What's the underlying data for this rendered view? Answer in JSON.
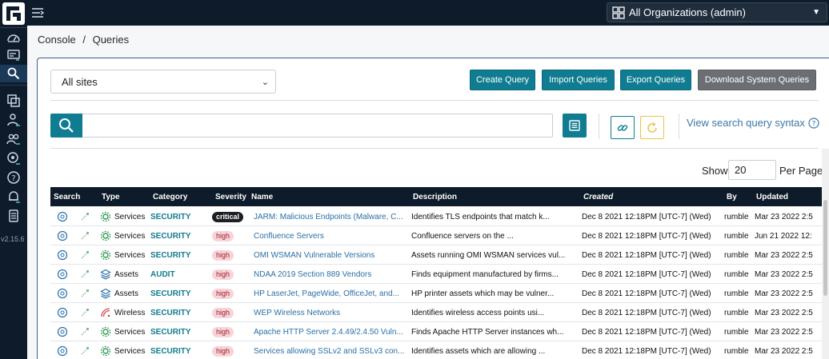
{
  "app": {
    "version": "v2.15.6",
    "brand_color": "#0d1b2a",
    "accent_color": "#107c91"
  },
  "topbar": {
    "org_select_label": "All Organizations (admin)"
  },
  "breadcrumb": {
    "root": "Console",
    "separator": "/",
    "current": "Queries"
  },
  "toolbar": {
    "site_select_value": "All sites",
    "create_query": "Create Query",
    "import_queries": "Import Queries",
    "export_queries": "Export Queries",
    "download_system_queries": "Download System Queries"
  },
  "search": {
    "query_value": "",
    "syntax_link": "View search query syntax"
  },
  "pagination": {
    "show_label": "Show",
    "page_size": "20",
    "per_page_label": "Per Page"
  },
  "table": {
    "columns": [
      "Search",
      "Type",
      "Category",
      "Severity",
      "Name",
      "Description",
      "Created",
      "By",
      "Updated"
    ],
    "rows": [
      {
        "type": "Services",
        "category": "SECURITY",
        "severity": "critical",
        "name": "JARM: Malicious Endpoints (Malware, C...",
        "description": "Identifies TLS endpoints that match k...",
        "created": "Dec 8 2021 12:18PM [UTC-7] (Wed)",
        "by": "rumble",
        "updated": "Mar 23 2022 2:5"
      },
      {
        "type": "Services",
        "category": "SECURITY",
        "severity": "high",
        "name": "Confluence Servers",
        "description": "Confluence servers on the ...",
        "created": "Dec 8 2021 12:18PM [UTC-7] (Wed)",
        "by": "rumble",
        "updated": "Jun 21 2022 12:"
      },
      {
        "type": "Services",
        "category": "SECURITY",
        "severity": "high",
        "name": "OMI WSMAN Vulnerable Versions",
        "description": "Assets running OMI WSMAN services vul...",
        "created": "Dec 8 2021 12:18PM [UTC-7] (Wed)",
        "by": "rumble",
        "updated": "Mar 23 2022 2:5"
      },
      {
        "type": "Assets",
        "category": "AUDIT",
        "severity": "high",
        "name": "NDAA 2019 Section 889 Vendors",
        "description": "Finds equipment manufactured by firms...",
        "created": "Dec 8 2021 12:18PM [UTC-7] (Wed)",
        "by": "rumble",
        "updated": "Mar 23 2022 2:5"
      },
      {
        "type": "Assets",
        "category": "SECURITY",
        "severity": "high",
        "name": "HP LaserJet, PageWide, OfficeJet, and...",
        "description": "HP printer assets which may be vulner...",
        "created": "Dec 8 2021 12:18PM [UTC-7] (Wed)",
        "by": "rumble",
        "updated": "Mar 23 2022 2:5"
      },
      {
        "type": "Wireless",
        "category": "SECURITY",
        "severity": "high",
        "name": "WEP Wireless Networks",
        "description": "Identifies wireless access points usi...",
        "created": "Dec 8 2021 12:18PM [UTC-7] (Wed)",
        "by": "rumble",
        "updated": "Mar 23 2022 2:5"
      },
      {
        "type": "Services",
        "category": "SECURITY",
        "severity": "high",
        "name": "Apache HTTP Server 2.4.49/2.4.50 Vuln...",
        "description": "Finds Apache HTTP Server instances wh...",
        "created": "Dec 8 2021 12:18PM [UTC-7] (Wed)",
        "by": "rumble",
        "updated": "Mar 23 2022 2:5"
      },
      {
        "type": "Services",
        "category": "SECURITY",
        "severity": "high",
        "name": "Services allowing SSLv2 and SSLv3 con...",
        "description": "Identifies assets which are allowing ...",
        "created": "Dec 8 2021 12:18PM [UTC-7] (Wed)",
        "by": "rumble",
        "updated": "Mar 23 2022 2:5"
      }
    ]
  }
}
